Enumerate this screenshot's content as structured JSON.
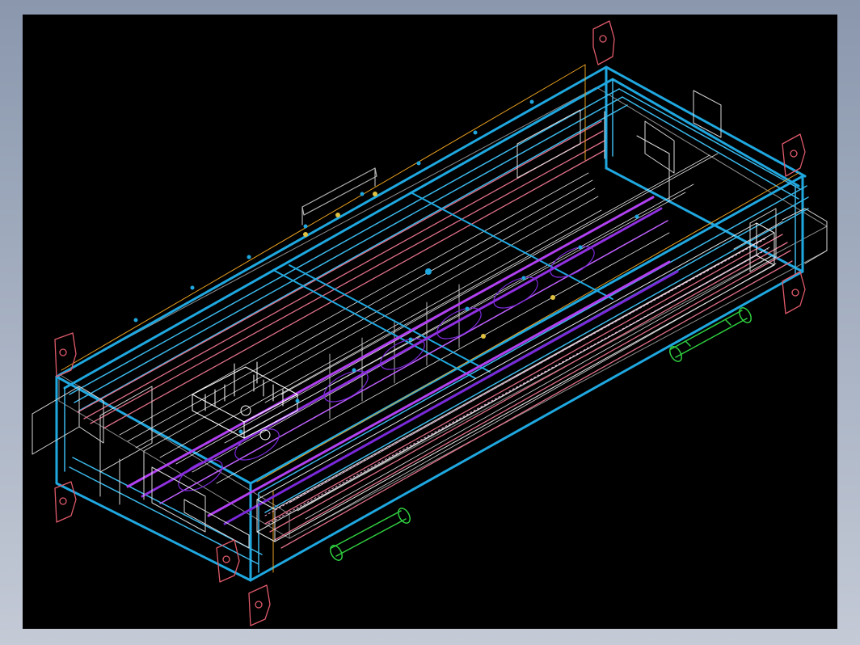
{
  "colors": {
    "page_background": "#a2adbf",
    "viewport_background": "#000000",
    "frame": "#1fa8e0",
    "frame_light": "#5bc8f0",
    "rail_pink": "#e07088",
    "bracket_red": "#e05a6a",
    "wire_white": "#e8e8e8",
    "wire_gray": "#9a9a9a",
    "edge_orange": "#e8a020",
    "tube_purple": "#b040f0",
    "tube_violet": "#7a28d8",
    "handle_green": "#30d040",
    "marker_yellow": "#e0c040"
  },
  "icons": {
    "bracket": "mounting-bracket-icon",
    "handle": "handle-icon",
    "fan_block": "heatsink-icon"
  }
}
